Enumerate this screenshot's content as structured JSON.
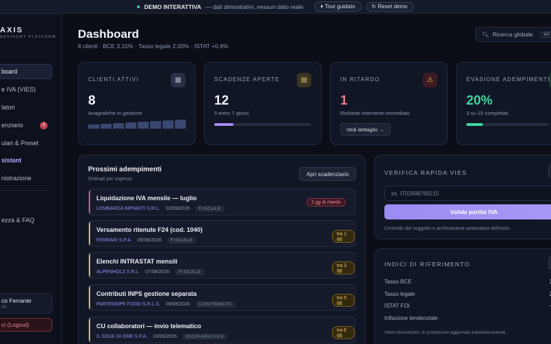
{
  "topbar": {
    "demo_label": "DEMO INTERATTIVA",
    "demo_text": "— dati dimostrativi, nessun dato reale",
    "tour_button": "⏵ Tour guidato",
    "reset_button": "↻ Reset demo"
  },
  "sidebar": {
    "logo": "AXIS",
    "logo_sub": "ADVISORY PLATFORM",
    "items": [
      {
        "label": "board"
      },
      {
        "label": "e IVA (VIES)"
      },
      {
        "label": "latori"
      },
      {
        "label": "enziario",
        "badge": "3"
      },
      {
        "label": "ulari & Preset"
      },
      {
        "label": "sistant"
      },
      {
        "label": "nistrazione"
      },
      {
        "label": "ezza & FAQ"
      }
    ],
    "user_name": "co Ferrante",
    "user_role": "IN",
    "logout": "ci (Logout)"
  },
  "header": {
    "title": "Dashboard",
    "subtitle": "8 clienti · BCE 3.15% · Tasso legale 2.00% · ISTAT +0.9%",
    "search_placeholder": "Ricerca globale",
    "search_kbd": "⌘K"
  },
  "stats": [
    {
      "label": "CLIENTI ATTIVI",
      "value": "8",
      "sub": "Anagrafiche in gestione",
      "icon": "building-icon",
      "icon_glyph": "▦"
    },
    {
      "label": "SCADENZE APERTE",
      "value": "12",
      "sub": "5 entro 7 giorni",
      "icon": "calendar-icon",
      "icon_glyph": "▤",
      "progress": 0.2
    },
    {
      "label": "IN RITARDO",
      "value": "1",
      "sub": "Richiede intervento immediato",
      "icon": "warning-icon",
      "icon_glyph": "⚠",
      "button": "Vedi dettaglio →"
    },
    {
      "label": "EVASIONE ADEMPIMENTI",
      "value": "20%",
      "sub": "3 su 15 completati",
      "icon": "check-icon",
      "icon_glyph": "✓",
      "progress": 0.2
    }
  ],
  "colors": {
    "purple": "#a78bfa",
    "red": "#f07d8d",
    "green": "#3dd6a0"
  },
  "deadlines": {
    "title": "Prossimi adempimenti",
    "subtitle": "Ordinati per urgenza",
    "open_button": "Apri scadenziario",
    "items": [
      {
        "name": "Liquidazione IVA mensile — luglio",
        "client": "LOMBARDA IMPIANTI S.R.L.",
        "date": "02/08/2026",
        "category": "FISCALE",
        "badge": "2 gg di ritardo",
        "urgent": true
      },
      {
        "name": "Versamento ritenute F24 (cod. 1040)",
        "client": "FERRARI S.P.A.",
        "date": "05/08/2026",
        "category": "FISCALE",
        "badge": "tra 1 gg",
        "urgent": false
      },
      {
        "name": "Elenchi INTRASTAT mensili",
        "client": "ALPENHOLZ S.R.L.",
        "date": "07/08/2026",
        "category": "FISCALE",
        "badge": "tra 3 gg",
        "urgent": false
      },
      {
        "name": "Contributi INPS gestione separata",
        "client": "PARTENOPE FOOD S.R.L.S.",
        "date": "09/08/2026",
        "category": "CONTRIBUTI",
        "badge": "tra 5 gg",
        "urgent": false
      },
      {
        "name": "CU collaboratori — invio telematico",
        "client": "IL SOLE 24 ORE S.P.A.",
        "date": "10/08/2026",
        "category": "DICHIARATIVO",
        "badge": "tra 6 gg",
        "urgent": false
      }
    ]
  },
  "vies": {
    "title": "VERIFICA RAPIDA VIES",
    "placeholder": "es. IT02998760215",
    "button": "Valida partita IVA",
    "note": "Controllo del soggetto e archiviazione automatica dell'esito."
  },
  "indices": {
    "title": "INDICI DI RIFERIMENTO",
    "rows": [
      {
        "label": "Tasso BCE",
        "value": "3"
      },
      {
        "label": "Tasso legale",
        "value": "2."
      },
      {
        "label": "ISTAT FOI",
        "value": "+("
      },
      {
        "label": "Inflazione tendenziale",
        "value": ""
      }
    ],
    "note": "Valori dimostrativi. In produzione aggiornati automaticamente."
  }
}
